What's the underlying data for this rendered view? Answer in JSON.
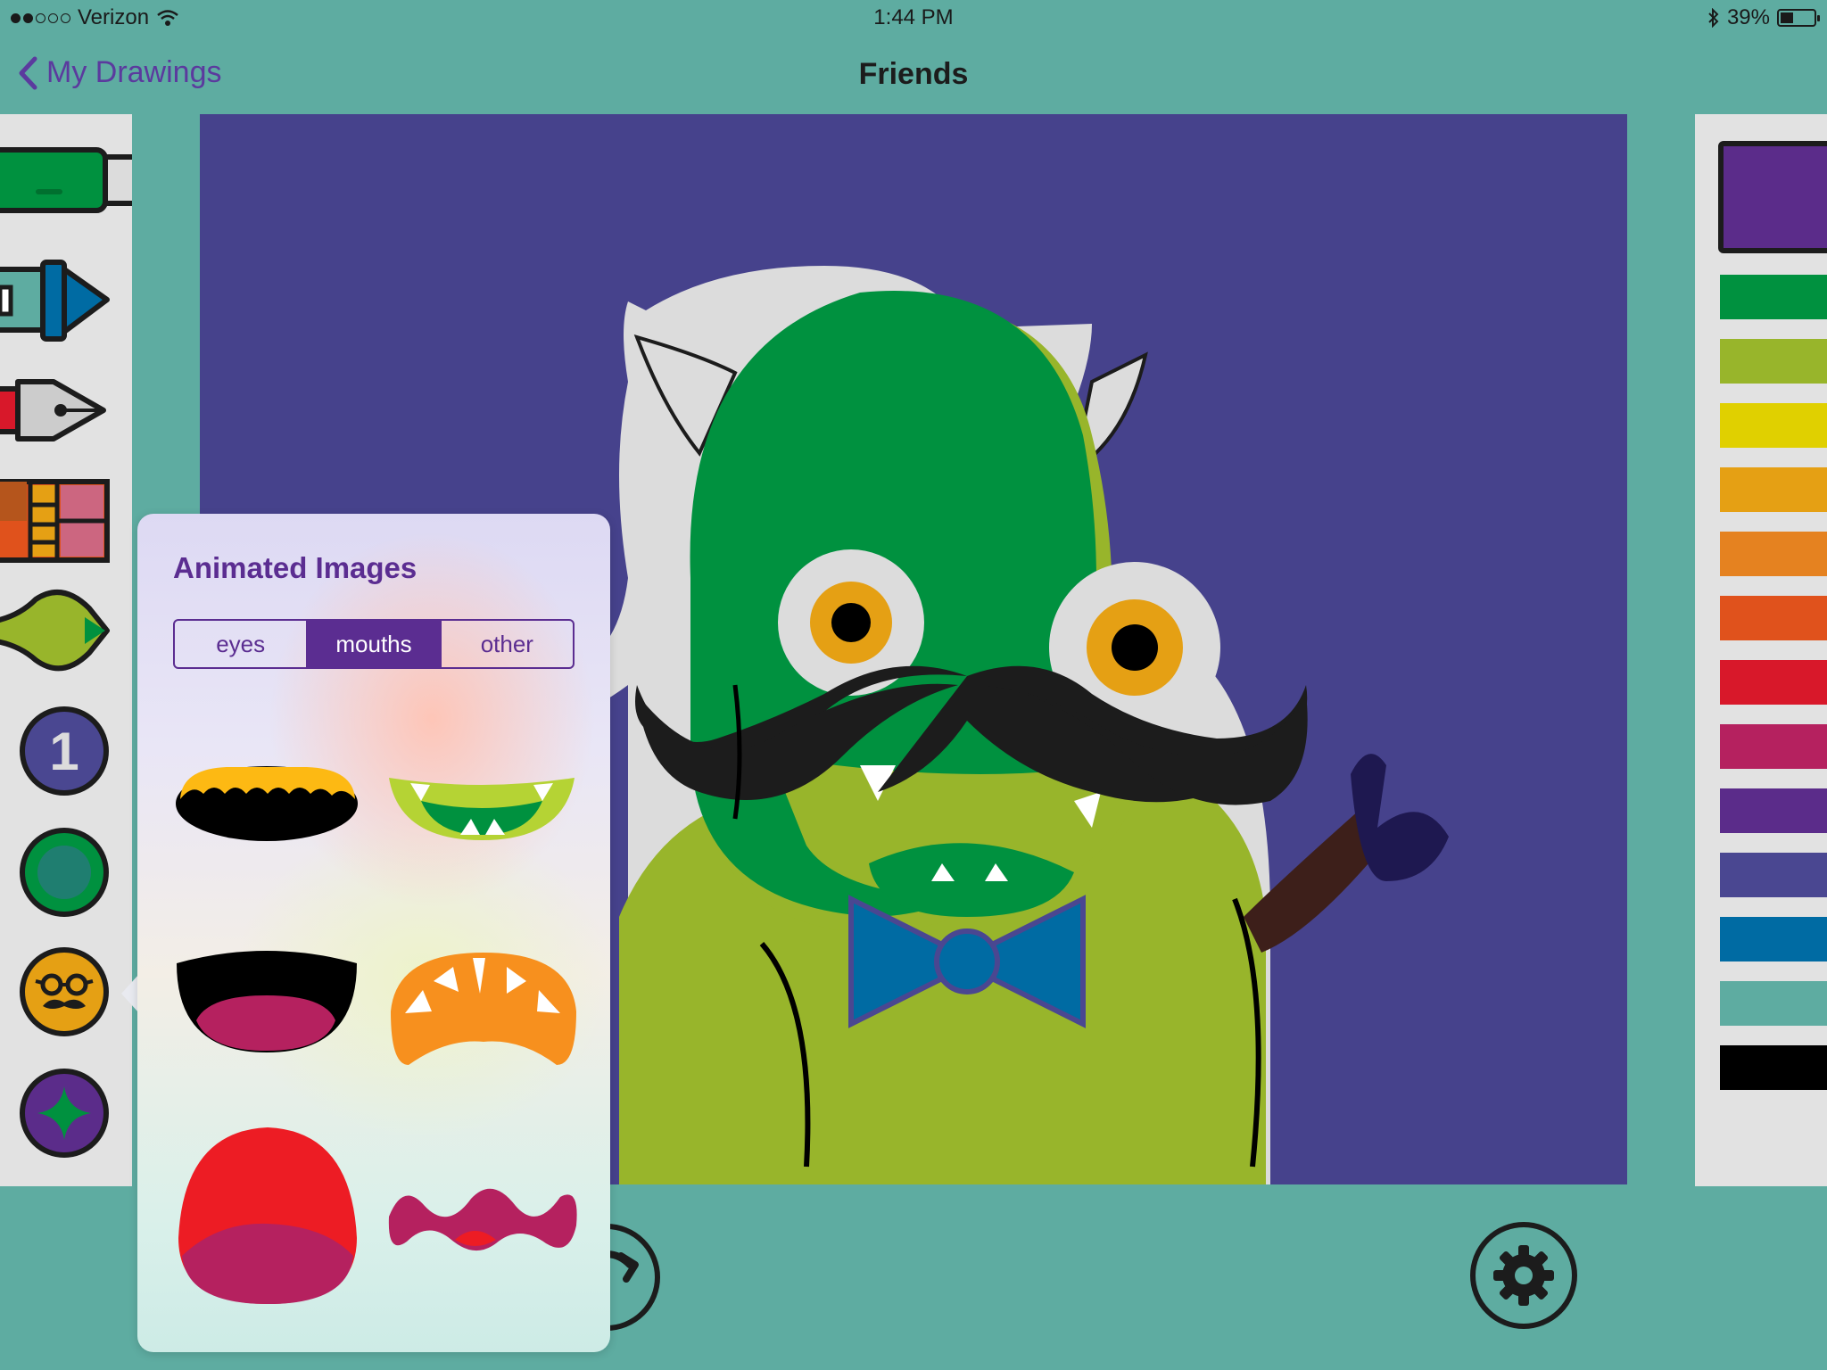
{
  "status_bar": {
    "carrier": "Verizon",
    "time": "1:44 PM",
    "battery": "39%",
    "battery_level": 0.39
  },
  "nav": {
    "back_label": "My Drawings",
    "title": "Friends"
  },
  "tools": {
    "layer_number": "1",
    "items": [
      "marker-tool",
      "crayon-tool",
      "pen-tool",
      "pattern-tool",
      "brush-tool",
      "layer-tool",
      "shape-tool",
      "stickers-tool",
      "effects-tool"
    ]
  },
  "palette": {
    "selected_color": "#5b2c8a",
    "colors": [
      "#00913f",
      "#98b52b",
      "#e0d000",
      "#e5a014",
      "#e58220",
      "#e0521c",
      "#d8182a",
      "#b5215f",
      "#5b2c8a",
      "#4a4791",
      "#006ba3",
      "#5eaca1",
      "#000000"
    ]
  },
  "popover": {
    "title": "Animated Images",
    "tabs": [
      "eyes",
      "mouths",
      "other"
    ],
    "active_tab": "mouths",
    "items": [
      "mouth-scalloped",
      "mouth-green-fangs",
      "mouth-open-smile",
      "mouth-orange-teeth",
      "mouth-red-round",
      "mouth-wavy"
    ]
  }
}
